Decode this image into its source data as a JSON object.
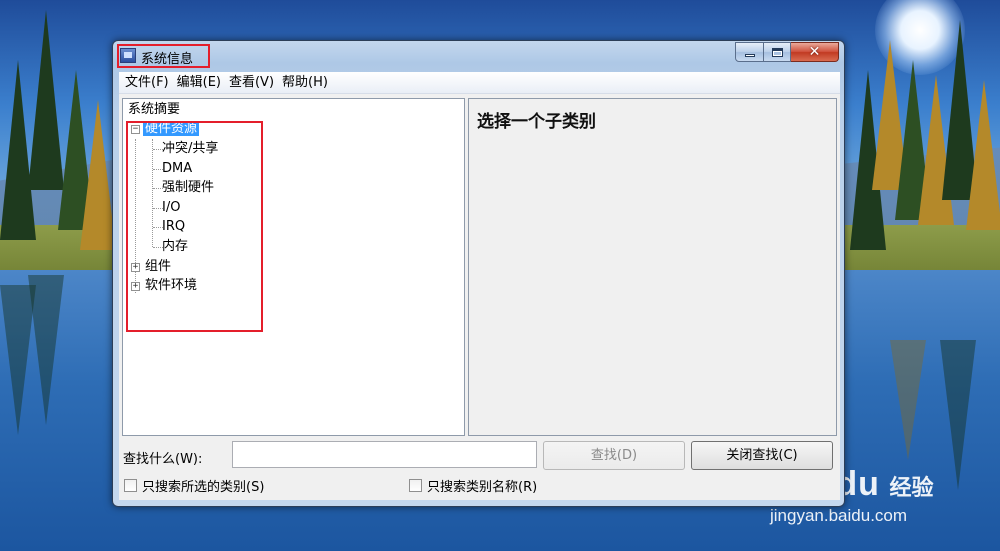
{
  "window": {
    "title": "系统信息",
    "minimize": "_",
    "maximize": "□",
    "close": "✕"
  },
  "menu": [
    {
      "label": "文件(F)"
    },
    {
      "label": "编辑(E)"
    },
    {
      "label": "查看(V)"
    },
    {
      "label": "帮助(H)"
    }
  ],
  "tree": {
    "root": "系统摘要",
    "hardware": "硬件资源",
    "hardware_children": [
      "冲突/共享",
      "DMA",
      "强制硬件",
      "I/O",
      "IRQ",
      "内存"
    ],
    "components": "组件",
    "software": "软件环境",
    "expanded_glyph": "−",
    "collapsed_glyph": "+"
  },
  "details": {
    "heading": "选择一个子类别"
  },
  "find": {
    "label": "查找什么(W):",
    "value": "",
    "find_button": "查找(D)",
    "close_find_button": "关闭查找(C)",
    "checkbox_selected": "只搜索所选的类别(S)",
    "checkbox_names": "只搜索类别名称(R)"
  },
  "watermark": {
    "logo": "Bai du",
    "sub": "经验",
    "url": "jingyan.baidu.com"
  },
  "colors": {
    "selection": "#3399ff",
    "highlight_box": "#e41e2b"
  }
}
